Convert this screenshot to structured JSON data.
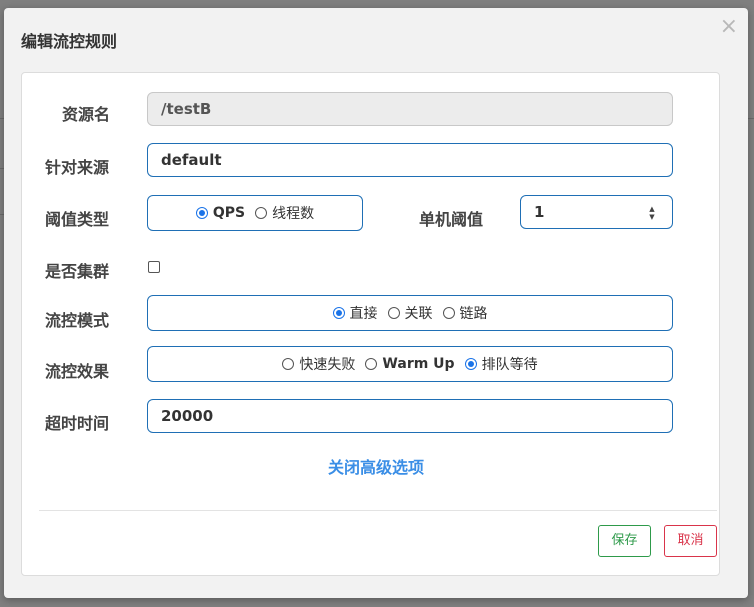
{
  "dialog": {
    "title": "编辑流控规则",
    "close_glyph": "×"
  },
  "form": {
    "resource": {
      "label": "资源名",
      "value": "/testB"
    },
    "limit_app": {
      "label": "针对来源",
      "value": "default"
    },
    "threshold_type": {
      "label": "阈值类型",
      "options": [
        "QPS",
        "线程数"
      ],
      "selected": "QPS"
    },
    "threshold": {
      "label": "单机阈值",
      "value": "1"
    },
    "cluster": {
      "label": "是否集群",
      "checked": false
    },
    "mode": {
      "label": "流控模式",
      "options": [
        "直接",
        "关联",
        "链路"
      ],
      "selected": "直接"
    },
    "effect": {
      "label": "流控效果",
      "options": [
        "快速失败",
        "Warm Up",
        "排队等待"
      ],
      "selected": "排队等待"
    },
    "timeout": {
      "label": "超时时间",
      "value": "20000"
    },
    "advanced_link": "关闭高级选项"
  },
  "footer": {
    "save_label": "保存",
    "cancel_label": "取消"
  },
  "colors": {
    "primary": "#1f6fb5",
    "radio_accent": "#1a73e8",
    "link": "#3a8ee6",
    "save": "#2e9a4a",
    "cancel": "#d9344a"
  },
  "icons": {
    "close": "close-icon",
    "spinner": "spinner-arrows-icon"
  }
}
